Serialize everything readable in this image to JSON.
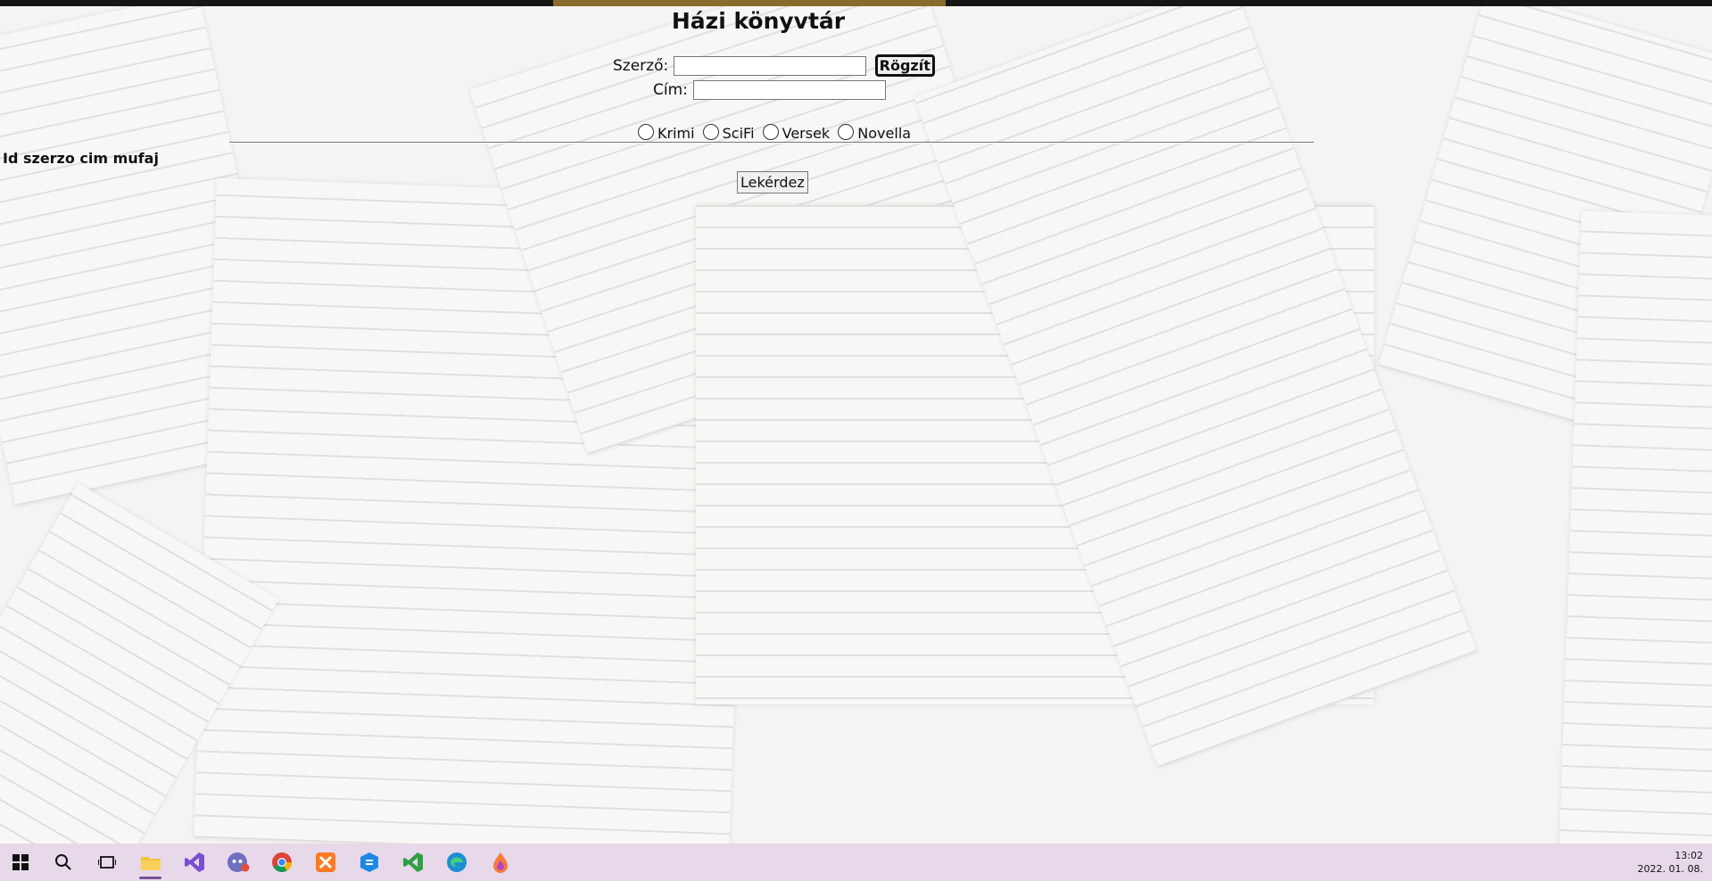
{
  "window": {
    "title": "Házi könyvtár"
  },
  "form": {
    "author_label": "Szerző:",
    "author_value": "",
    "title_label": "Cím:",
    "title_value": "",
    "save_button": "Rögzít",
    "genres": [
      "Krimi",
      "SciFi",
      "Versek",
      "Novella"
    ]
  },
  "table": {
    "header": "Id szerzo cim mufaj"
  },
  "query_button": "Lekérdez",
  "taskbar": {
    "icons": [
      "windows-start-icon",
      "search-icon",
      "task-view-icon",
      "file-explorer-icon",
      "visual-studio-icon",
      "discord-icon",
      "chrome-icon",
      "xampp-icon",
      "app-icon",
      "vs-code-icon",
      "edge-icon",
      "paint-icon"
    ],
    "time": "13:02",
    "date": "2022. 01. 08."
  }
}
